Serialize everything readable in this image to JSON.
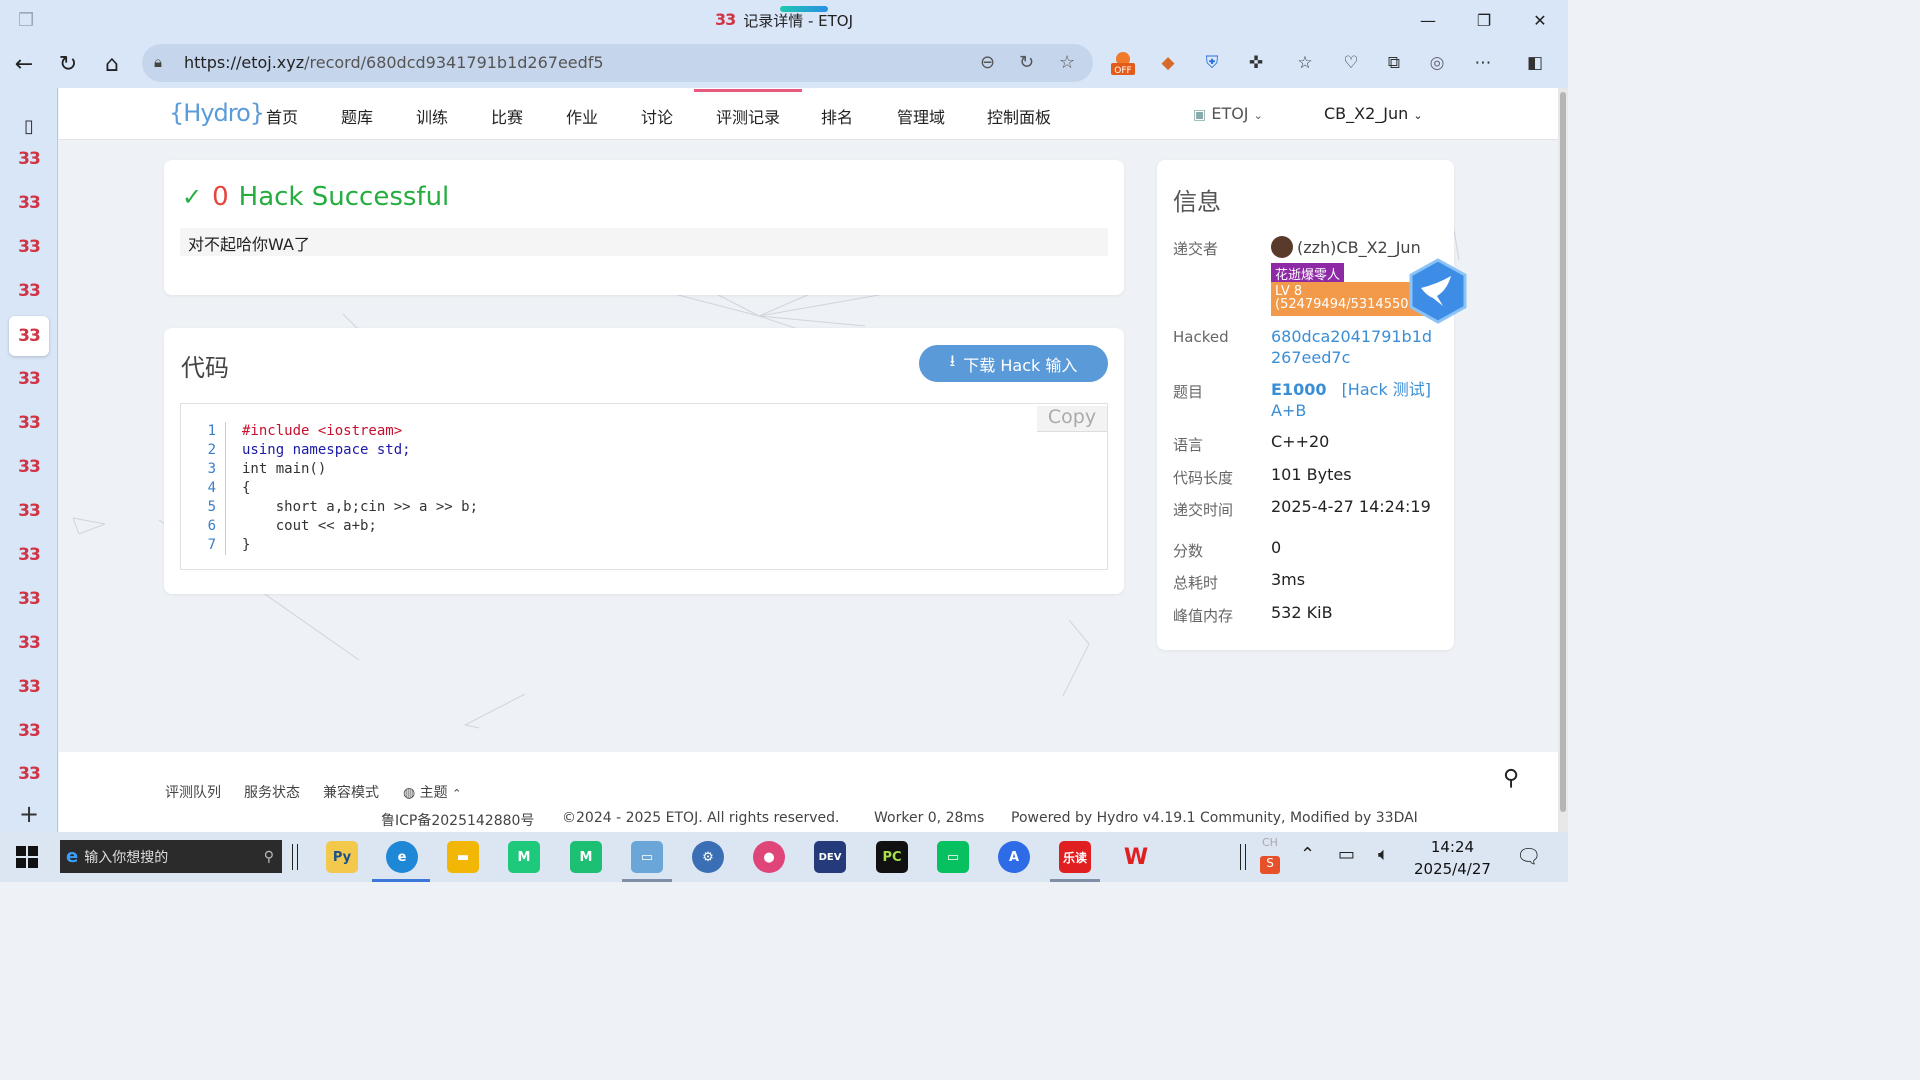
{
  "window": {
    "title": "记录详情 - ETOJ",
    "minimize": "—",
    "restore": "❐",
    "close": "✕"
  },
  "browser": {
    "url_host": "https://etoj.xyz",
    "url_path": "/record/680dcd9341791b1d267eedf5",
    "extension_badge": "OFF"
  },
  "site_favicon_text": "33",
  "nav": {
    "logo": "{Hydro}",
    "items": [
      "首页",
      "题库",
      "训练",
      "比赛",
      "作业",
      "讨论",
      "评测记录",
      "排名",
      "管理域",
      "控制面板"
    ],
    "domain": "ETOJ",
    "user": "CB_X2_Jun"
  },
  "status": {
    "check": "✓",
    "score": "0",
    "text": "Hack Successful",
    "message": "对不起哈你WA了"
  },
  "code": {
    "title": "代码",
    "download_label": "下载 Hack 输入",
    "copy_label": "Copy",
    "lines": [
      {
        "n": "1",
        "text": "#include <iostream>"
      },
      {
        "n": "2",
        "text": "using namespace std;"
      },
      {
        "n": "3",
        "text": "int main()"
      },
      {
        "n": "4",
        "text": "{"
      },
      {
        "n": "5",
        "text": "    short a,b;cin >> a >> b;"
      },
      {
        "n": "6",
        "text": "    cout << a+b;"
      },
      {
        "n": "7",
        "text": "}"
      }
    ]
  },
  "info": {
    "title": "信息",
    "submitter_label": "递交者",
    "submitter": "(zzh)CB_X2_Jun",
    "badge_title": "花逝爆零人",
    "badge_level": "LV 8",
    "badge_exp": "(52479494/5314550",
    "hacked_label": "Hacked",
    "hacked_id": "680dca2041791b1d267eed7c",
    "problem_label": "题目",
    "problem_id": "E1000",
    "problem_tag": "[Hack 测试]",
    "problem_name": "A+B",
    "language_label": "语言",
    "language": "C++20",
    "code_len_label": "代码长度",
    "code_len": "101 Bytes",
    "submit_time_label": "递交时间",
    "submit_time": "2025-4-27 14:24:19",
    "score_label": "分数",
    "score": "0",
    "time_label": "总耗时",
    "time": "3ms",
    "memory_label": "峰值内存",
    "memory": "532 KiB"
  },
  "footer": {
    "links": [
      "评测队列",
      "服务状态",
      "兼容模式",
      "主题"
    ],
    "icp": "鲁ICP备2025142880号",
    "copyright": "©2024 - 2025 ETOJ. All rights reserved.",
    "worker": "Worker 0, 28ms",
    "powered": "Powered by Hydro v4.19.1 Community, Modified by 33DAI"
  },
  "taskbar": {
    "search_placeholder": "输入你想搜的",
    "time": "14:24",
    "date": "2025/4/27",
    "ime": "CH",
    "apps": [
      {
        "icon": "python-icon",
        "label": "Py",
        "color": "#f2c94c"
      },
      {
        "icon": "edge-icon",
        "label": "e",
        "color": "#1f88d6"
      },
      {
        "icon": "folder-icon",
        "label": "▬",
        "color": "#f2b705"
      },
      {
        "icon": "clion-icon",
        "label": "M",
        "color": "#1fc97c"
      },
      {
        "icon": "wps-green-icon",
        "label": "M",
        "color": "#1dbf73"
      },
      {
        "icon": "notepad-icon",
        "label": "▭",
        "color": "#6aa7d8"
      },
      {
        "icon": "steam-icon",
        "label": "⚙",
        "color": "#3a6fb5"
      },
      {
        "icon": "paint-icon",
        "label": "●",
        "color": "#e0457a"
      },
      {
        "icon": "devcpp-icon",
        "label": "DEV",
        "color": "#243a7a"
      },
      {
        "icon": "pycharm-icon",
        "label": "PC",
        "color": "#111111"
      },
      {
        "icon": "wechat-icon",
        "label": "▭",
        "color": "#07c160"
      },
      {
        "icon": "feishu-icon",
        "label": "A",
        "color": "#2e6be6"
      },
      {
        "icon": "ledu-icon",
        "label": "乐读",
        "color": "#e02020"
      },
      {
        "icon": "wps-icon",
        "label": "W",
        "color": "#ffffff"
      }
    ]
  }
}
